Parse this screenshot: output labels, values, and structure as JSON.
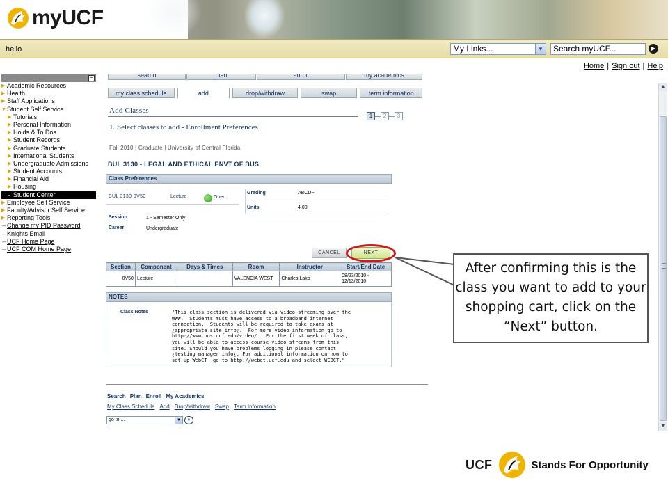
{
  "header": {
    "logo_text": "myUCF",
    "greeting": "hello",
    "mylinks_value": "My Links...",
    "search_value": "Search myUCF...",
    "links": [
      "Home",
      "Sign out",
      "Help"
    ]
  },
  "menu": {
    "items": [
      {
        "label": "Academic Resources",
        "level": 1
      },
      {
        "label": "Health",
        "level": 1
      },
      {
        "label": "Staff Applications",
        "level": 1
      },
      {
        "label": "Student Self Service",
        "level": 1
      },
      {
        "label": "Tutorials",
        "level": 2
      },
      {
        "label": "Personal Information",
        "level": 2
      },
      {
        "label": "Holds & To Dos",
        "level": 2
      },
      {
        "label": "Student Records",
        "level": 2
      },
      {
        "label": "Graduate Students",
        "level": 2
      },
      {
        "label": "International Students",
        "level": 2
      },
      {
        "label": "Undergraduate Admissions",
        "level": 2
      },
      {
        "label": "Student Accounts",
        "level": 2
      },
      {
        "label": "Financial Aid",
        "level": 2
      },
      {
        "label": "Housing",
        "level": 2
      },
      {
        "label": "Student Center",
        "level": 2
      },
      {
        "label": "Employee Self Service",
        "level": 1
      },
      {
        "label": "Faculty/Advisor Self Service",
        "level": 1
      },
      {
        "label": "Reporting Tools",
        "level": 1
      },
      {
        "label": "Change my PID Password",
        "level": 1
      },
      {
        "label": "Knights Email",
        "level": 1
      },
      {
        "label": "UCF Home Page",
        "level": 1
      },
      {
        "label": "UCF COM Home Page",
        "level": 1
      }
    ]
  },
  "tabs": {
    "top": [
      "search",
      "plan",
      "enroll",
      "my academics"
    ],
    "bottom": [
      "my class schedule",
      "add",
      "drop/withdraw",
      "swap",
      "term information"
    ],
    "active": "add"
  },
  "page": {
    "title": "Add Classes",
    "steps": [
      "1",
      "2",
      "3"
    ],
    "subtitle": "1.  Select classes to add - Enrollment Preferences",
    "term": "Fall 2010 | Graduate | University of Central Florida",
    "course": "BUL 3130 - LEGAL AND ETHICAL ENVT OF BUS"
  },
  "preferences": {
    "header": "Class Preferences",
    "class_section": "BUL 3130-0V50",
    "component": "Lecture",
    "status": "Open",
    "grading_label": "Grading",
    "grading_value": "ABCDF",
    "units_label": "Units",
    "units_value": "4.00",
    "session_label": "Session",
    "session_value": "1 - Semester Only",
    "career_label": "Career",
    "career_value": "Undergraduate"
  },
  "buttons": {
    "cancel": "CANCEL",
    "next": "NEXT"
  },
  "section_table": {
    "headers": [
      "Section",
      "Component",
      "Days & Times",
      "Room",
      "Instructor",
      "Start/End Date"
    ],
    "row": {
      "section": "0V50",
      "component": "Lecture",
      "days": "",
      "room": "VALENCIA WEST",
      "instructor": "Charles Lako",
      "dates": "08/23/2010 - 12/13/2010"
    }
  },
  "notes": {
    "header": "NOTES",
    "label": "Class Notes",
    "text": "\"This class section is delivered via video streaming over the WWW.  Students must have access to a broadband internet connection.  Students will be required to take exams at ¿appropriate site info¿.  For more video information go to http://www.bus.ucf.edu/video/.  For the first week of class, you will be able to access course video streams from this site. Should you have problems logging in please contact ¿testing manager info¿. For additional information on how to set-up WebCT  go to http://webct.ucf.edu and select WEBCT.\""
  },
  "footer_nav": {
    "row1": [
      "Search",
      "Plan",
      "Enroll",
      "My Academics"
    ],
    "row2": [
      "My Class Schedule",
      "Add",
      "Drop/withdraw",
      "Swap",
      "Term Information"
    ],
    "goto": "go to ..."
  },
  "callout": {
    "text": "After confirming this is the class you want to add to your shopping cart, click on the “Next” button."
  },
  "footer_brand": {
    "ucf": "UCF",
    "tagline": "Stands For Opportunity"
  },
  "colors": {
    "highlight": "#d01818",
    "heading": "#13325f",
    "menu_arrow": "#d8a300"
  }
}
